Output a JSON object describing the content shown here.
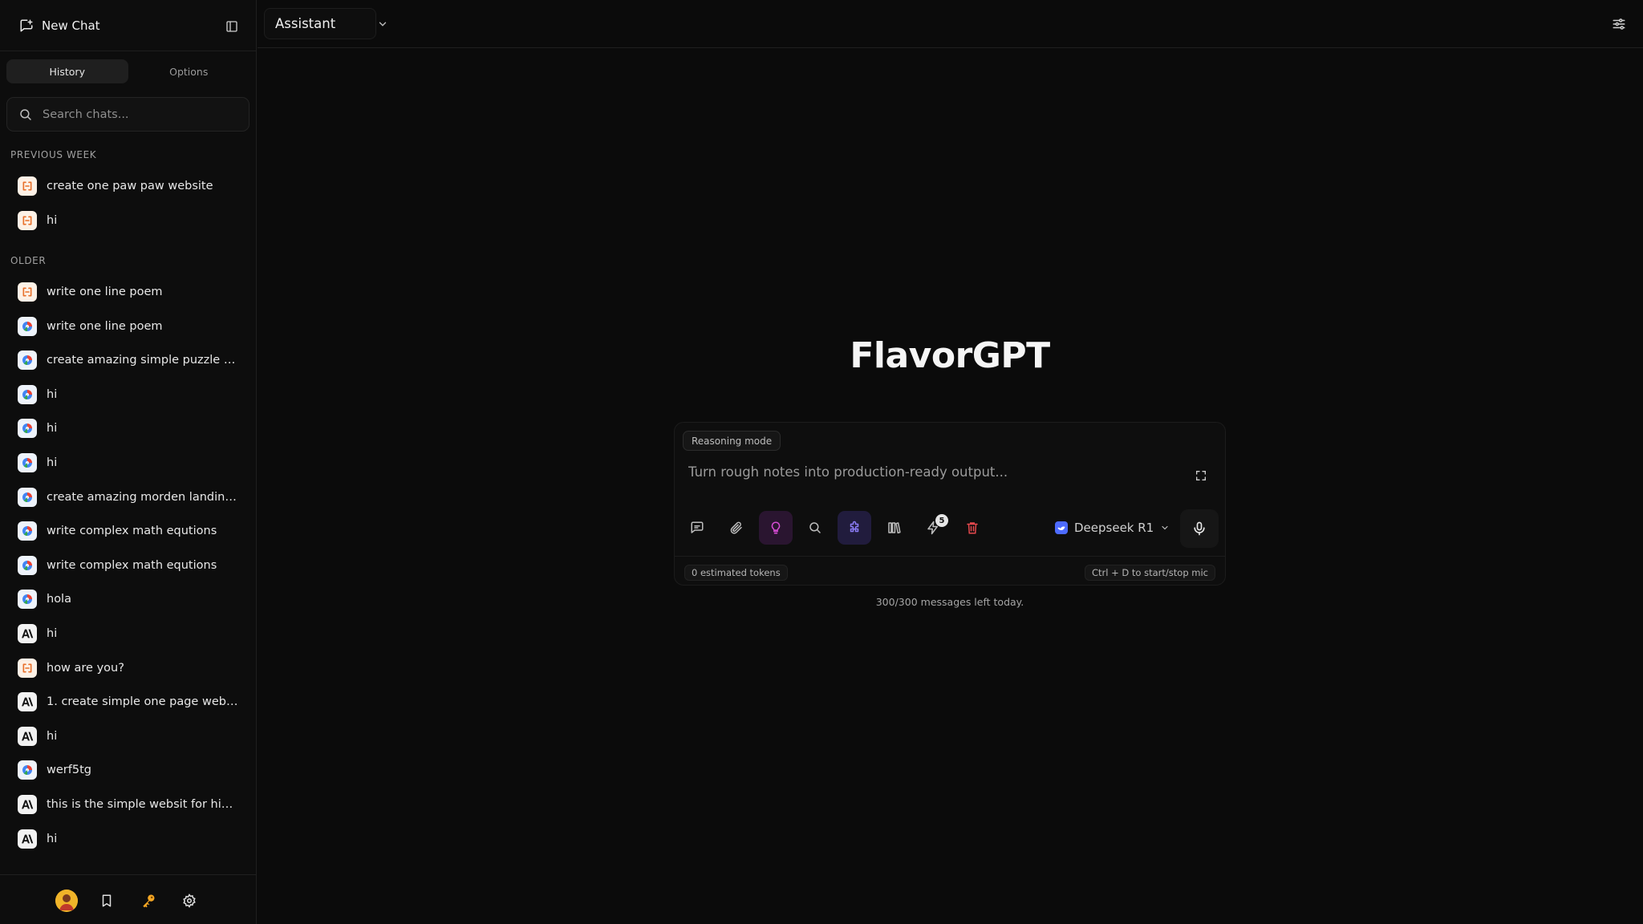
{
  "sidebar": {
    "new_chat_label": "New Chat",
    "tabs": [
      {
        "label": "History",
        "active": true
      },
      {
        "label": "Options",
        "active": false
      }
    ],
    "search_placeholder": "Search chats...",
    "sections": [
      {
        "label": "PREVIOUS WEEK",
        "items": [
          {
            "label": "create one paw paw website",
            "icon": "qwen-logo-icon"
          },
          {
            "label": "hi",
            "icon": "qwen-logo-icon"
          }
        ]
      },
      {
        "label": "OLDER",
        "items": [
          {
            "label": "write one line poem",
            "icon": "qwen-logo-icon"
          },
          {
            "label": "write one line poem",
            "icon": "gemini-logo-icon"
          },
          {
            "label": "create amazing simple puzzle g...",
            "icon": "gemini-logo-icon"
          },
          {
            "label": "hi",
            "icon": "gemini-logo-icon"
          },
          {
            "label": "hi",
            "icon": "gemini-logo-icon"
          },
          {
            "label": "hi",
            "icon": "gemini-logo-icon"
          },
          {
            "label": "create amazing morden landing ...",
            "icon": "gemini-logo-icon"
          },
          {
            "label": "write complex math equtions",
            "icon": "gemini-logo-icon"
          },
          {
            "label": "write complex math equtions",
            "icon": "gemini-logo-icon"
          },
          {
            "label": "hola",
            "icon": "gemini-logo-icon"
          },
          {
            "label": "hi",
            "icon": "anthropic-logo-icon"
          },
          {
            "label": "how are you?",
            "icon": "qwen-logo-icon"
          },
          {
            "label": "1. create simple one page websi...",
            "icon": "anthropic-logo-icon"
          },
          {
            "label": "hi",
            "icon": "anthropic-logo-icon"
          },
          {
            "label": "werf5tg",
            "icon": "gemini-logo-icon"
          },
          {
            "label": "this is the simple websit for hiki...",
            "icon": "anthropic-logo-icon"
          },
          {
            "label": "hi",
            "icon": "anthropic-logo-icon"
          }
        ]
      }
    ],
    "footer_icons": [
      "avatar",
      "bookmark-icon",
      "key-icon",
      "gear-icon"
    ]
  },
  "topbar": {
    "assistant_label": "Assistant"
  },
  "main": {
    "brand_title": "FlavorGPT",
    "composer": {
      "mode_chip": "Reasoning mode",
      "placeholder": "Turn rough notes into production-ready output...",
      "tools_badge_count": "5",
      "model_label": "Deepseek R1",
      "tokens_label": "0 estimated tokens",
      "mic_hint": "Ctrl + D to start/stop mic"
    },
    "quota_text": "300/300 messages left today."
  },
  "colors": {
    "background": "#0b0b0b",
    "sidebar": "#0d0d0d",
    "reasoning_active": "#2a1530",
    "tools_active": "#211c3d",
    "delete_red": "#e5484d",
    "deepseek_blue": "#4d6bfe"
  }
}
